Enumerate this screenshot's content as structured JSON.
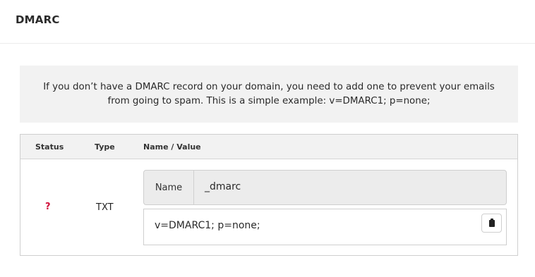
{
  "panel": {
    "title": "DMARC"
  },
  "notice": {
    "text": "If you don’t have a DMARC record on your domain, you need to add one to prevent your emails from going to spam. This is a simple example: v=DMARC1; p=none;"
  },
  "table": {
    "columns": [
      "Status",
      "Type",
      "Name / Value"
    ],
    "row": {
      "status": "?",
      "type": "TXT",
      "name_label": "Name",
      "name_value": "_dmarc",
      "value": "v=DMARC1; p=none;"
    }
  },
  "icons": {
    "copy": "clipboard-icon"
  },
  "colors": {
    "status_unknown": "#d0103a",
    "notice_background": "#f2f2f2"
  }
}
